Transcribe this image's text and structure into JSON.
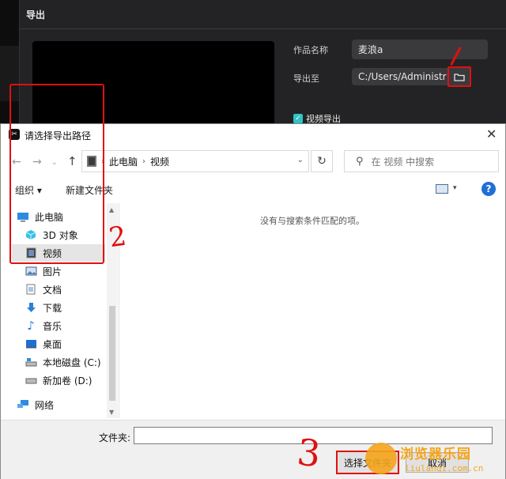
{
  "export_panel": {
    "title": "导出",
    "name_label": "作品名称",
    "name_value": "麦浪a",
    "export_to_label": "导出至",
    "export_path": "C:/Users/Administrator/...",
    "video_export_label": "视频导出"
  },
  "dialog": {
    "title": "请选择导出路径",
    "close": "✕",
    "address": {
      "segments": [
        "此电脑",
        "视频"
      ]
    },
    "search_placeholder": "在 视频 中搜索",
    "toolbar": {
      "organize": "组织 ▾",
      "new_folder": "新建文件夹",
      "help": "?"
    },
    "nav_items": [
      {
        "label": "此电脑",
        "icon": "computer-icon"
      },
      {
        "label": "3D 对象",
        "icon": "cube-icon"
      },
      {
        "label": "视频",
        "icon": "video-icon",
        "selected": true
      },
      {
        "label": "图片",
        "icon": "picture-icon"
      },
      {
        "label": "文档",
        "icon": "document-icon"
      },
      {
        "label": "下载",
        "icon": "download-icon"
      },
      {
        "label": "音乐",
        "icon": "music-icon"
      },
      {
        "label": "桌面",
        "icon": "desktop-icon"
      },
      {
        "label": "本地磁盘 (C:)",
        "icon": "drive-icon"
      },
      {
        "label": "新加卷 (D:)",
        "icon": "drive-icon"
      },
      {
        "label": "网络",
        "icon": "network-icon"
      }
    ],
    "empty_message": "没有与搜索条件匹配的项。",
    "file_label": "文件夹:",
    "file_value": "",
    "save_label": "选择文件夹",
    "cancel_label": "取消"
  },
  "annotations": {
    "mark1": "/",
    "mark2": "2",
    "mark3": "3"
  },
  "watermark": {
    "text": "浏览器乐园",
    "url": "liulanqi.com.cn"
  },
  "colors": {
    "highlight_red": "#e01010",
    "accent_teal": "#2ec4c4",
    "help_blue": "#1f6fd6"
  }
}
